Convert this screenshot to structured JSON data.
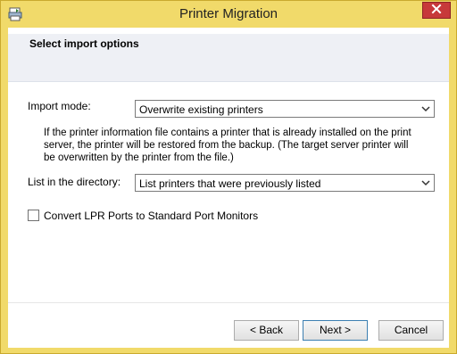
{
  "window": {
    "title": "Printer Migration",
    "accent_color": "#f1da6a",
    "close_color": "#c7393a"
  },
  "page": {
    "section_title": "Select import options"
  },
  "import_mode": {
    "label": "Import mode:",
    "selected": "Overwrite existing printers",
    "description": "If the printer information file contains a printer that is already installed on the print server, the printer will be restored from the backup.  (The target server printer will be overwritten by the printer from the file.)"
  },
  "directory": {
    "label": "List in the directory:",
    "selected": "List printers that were previously listed"
  },
  "lpr_option": {
    "label": "Convert LPR Ports to Standard Port Monitors",
    "checked": false
  },
  "buttons": {
    "back": "< Back",
    "next": "Next >",
    "cancel": "Cancel"
  },
  "icons": {
    "app": "printer-migration-icon",
    "close": "close-icon",
    "dropdown": "chevron-down-icon"
  }
}
